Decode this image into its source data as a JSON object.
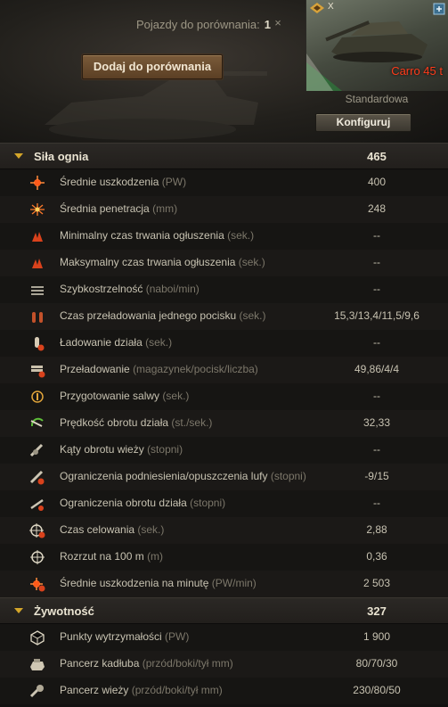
{
  "compare": {
    "label": "Pojazdy do porównania:",
    "count": "1",
    "close": "×"
  },
  "add_button": "Dodaj do porównania",
  "tank": {
    "tier": "X",
    "name": "Carro 45 t",
    "configuration": "Standardowa",
    "configure_button": "Konfiguruj"
  },
  "sections": [
    {
      "title": "Siła ognia",
      "value": "465",
      "rows": [
        {
          "icon": "damage-icon",
          "label": "Średnie uszkodzenia",
          "unit": "(PW)",
          "value": "400"
        },
        {
          "icon": "penetration-icon",
          "label": "Średnia penetracja",
          "unit": "(mm)",
          "value": "248"
        },
        {
          "icon": "stun-min-icon",
          "label": "Minimalny czas trwania ogłuszenia",
          "unit": "(sek.)",
          "value": "--"
        },
        {
          "icon": "stun-max-icon",
          "label": "Maksymalny czas trwania ogłuszenia",
          "unit": "(sek.)",
          "value": "--"
        },
        {
          "icon": "rate-of-fire-icon",
          "label": "Szybkostrzelność",
          "unit": "(naboi/min)",
          "value": "--"
        },
        {
          "icon": "shell-reload-icon",
          "label": "Czas przeładowania jednego pocisku",
          "unit": "(sek.)",
          "value": "15,3/13,4/11,5/9,6"
        },
        {
          "icon": "gun-loading-icon",
          "label": "Ładowanie działa",
          "unit": "(sek.)",
          "value": "--"
        },
        {
          "icon": "magazine-reload-icon",
          "label": "Przeładowanie",
          "unit": "(magazynek/pocisk/liczba)",
          "value": "49,86/4/4"
        },
        {
          "icon": "salvo-icon",
          "label": "Przygotowanie salwy",
          "unit": "(sek.)",
          "value": "--"
        },
        {
          "icon": "gun-traverse-speed-icon",
          "label": "Prędkość obrotu działa",
          "unit": "(st./sek.)",
          "value": "32,33"
        },
        {
          "icon": "turret-angle-icon",
          "label": "Kąty obrotu wieży",
          "unit": "(stopni)",
          "value": "--"
        },
        {
          "icon": "elevation-icon",
          "label": "Ograniczenia podniesienia/opuszczenia lufy",
          "unit": "(stopni)",
          "value": "-9/15"
        },
        {
          "icon": "gun-traverse-limit-icon",
          "label": "Ograniczenia obrotu działa",
          "unit": "(stopni)",
          "value": "--"
        },
        {
          "icon": "aiming-time-icon",
          "label": "Czas celowania",
          "unit": "(sek.)",
          "value": "2,88"
        },
        {
          "icon": "dispersion-icon",
          "label": "Rozrzut na 100 m",
          "unit": "(m)",
          "value": "0,36"
        },
        {
          "icon": "damage-per-minute-icon",
          "label": "Średnie uszkodzenia na minutę",
          "unit": "(PW/min)",
          "value": "2 503"
        }
      ]
    },
    {
      "title": "Żywotność",
      "value": "327",
      "rows": [
        {
          "icon": "hit-points-icon",
          "label": "Punkty wytrzymałości",
          "unit": "(PW)",
          "value": "1 900"
        },
        {
          "icon": "hull-armor-icon",
          "label": "Pancerz kadłuba",
          "unit": "(przód/boki/tył mm)",
          "value": "80/70/30"
        },
        {
          "icon": "turret-armor-icon",
          "label": "Pancerz wieży",
          "unit": "(przód/boki/tył mm)",
          "value": "230/80/50"
        }
      ]
    }
  ]
}
